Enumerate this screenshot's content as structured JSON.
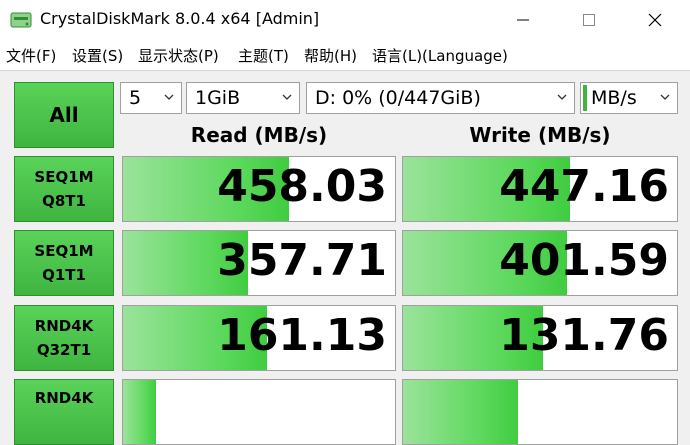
{
  "window": {
    "title": "CrystalDiskMark 8.0.4 x64 [Admin]",
    "controls": {
      "minimize": "—",
      "maximize": "☐",
      "close": "✕"
    }
  },
  "menu": {
    "items": [
      "文件(F)",
      "设置(S)",
      "显示状态(P)",
      "主题(T)",
      "帮助(H)",
      "语言(L)(Language)"
    ]
  },
  "toolbar": {
    "all_label": "All",
    "count": "5",
    "size": "1GiB",
    "drive": "D: 0% (0/447GiB)",
    "unit": "MB/s"
  },
  "columns": {
    "read": "Read (MB/s)",
    "write": "Write (MB/s)"
  },
  "tests": [
    {
      "line1": "SEQ1M",
      "line2": "Q8T1",
      "read": "458.03",
      "write": "447.16",
      "read_frac": 0.61,
      "write_frac": 0.61
    },
    {
      "line1": "SEQ1M",
      "line2": "Q1T1",
      "read": "357.71",
      "write": "401.59",
      "read_frac": 0.46,
      "write_frac": 0.6
    },
    {
      "line1": "RND4K",
      "line2": "Q32T1",
      "read": "161.13",
      "write": "131.76",
      "read_frac": 0.53,
      "write_frac": 0.51
    },
    {
      "line1": "RND4K",
      "line2": "",
      "read": "",
      "write": "",
      "read_frac": 0.12,
      "write_frac": 0.42
    }
  ],
  "colors": {
    "accent_green": "#3fb53f",
    "bar_green": "#5bd85b"
  }
}
